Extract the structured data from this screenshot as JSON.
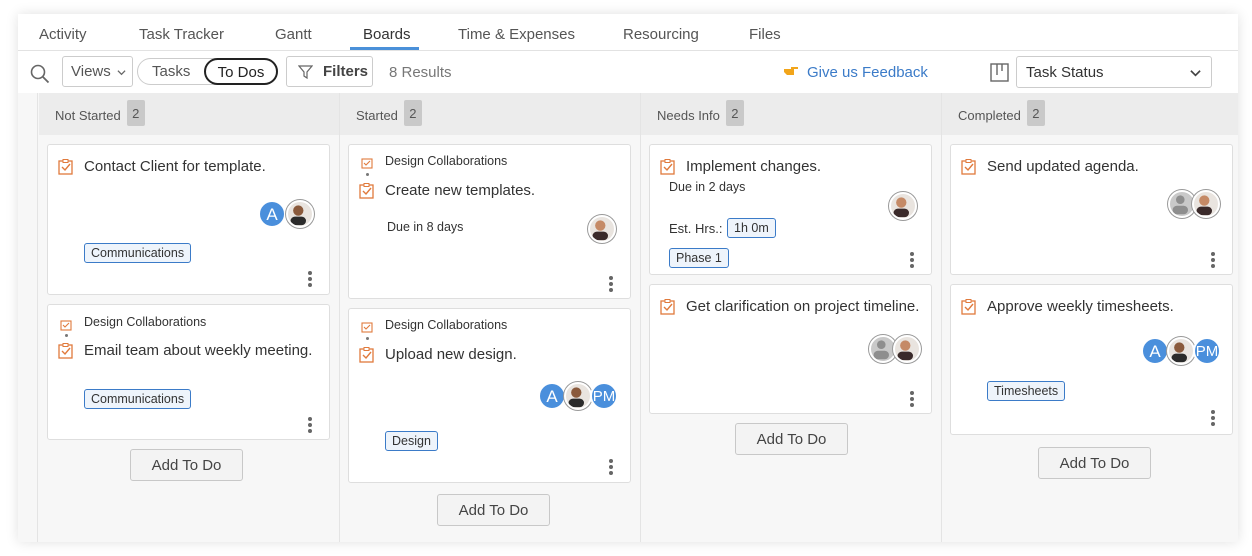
{
  "tabs": [
    {
      "label": "Activity"
    },
    {
      "label": "Task Tracker"
    },
    {
      "label": "Gantt"
    },
    {
      "label": "Boards"
    },
    {
      "label": "Time & Expenses"
    },
    {
      "label": "Resourcing"
    },
    {
      "label": "Files"
    }
  ],
  "active_tab": "Boards",
  "toolbar": {
    "search_icon": "search-icon",
    "views_label": "Views",
    "toggle_tasks": "Tasks",
    "toggle_todos": "To Dos",
    "filters_label": "Filters",
    "results": "8 Results",
    "feedback": "Give us Feedback",
    "group_by": "Task Status"
  },
  "colors": {
    "accent": "#4a90d9",
    "link": "#3b7bc8",
    "check": "#e07a3c",
    "avatar_blue": "#4a8fdc"
  },
  "columns": [
    {
      "title": "Not Started",
      "count": "2",
      "add_label": "Add To Do",
      "cards": [
        {
          "title": "Contact Client for template.",
          "tag": "Communications",
          "avatars": [
            "A",
            "photo"
          ]
        },
        {
          "parent": "Design Collaborations",
          "title": "Email team about weekly meeting.",
          "tag": "Communications"
        }
      ]
    },
    {
      "title": "Started",
      "count": "2",
      "add_label": "Add To Do",
      "cards": [
        {
          "parent": "Design Collaborations",
          "title": "Create new templates.",
          "due": "Due in 8 days",
          "avatars": [
            "photo"
          ]
        },
        {
          "parent": "Design Collaborations",
          "title": "Upload new design.",
          "tag": "Design",
          "avatars": [
            "A",
            "photo",
            "PM"
          ]
        }
      ]
    },
    {
      "title": "Needs Info",
      "count": "2",
      "add_label": "Add To Do",
      "cards": [
        {
          "title": "Implement changes.",
          "due": "Due in 2 days",
          "est_label": "Est. Hrs.:",
          "est_value": "1h 0m",
          "tag": "Phase 1",
          "avatars": [
            "photo"
          ]
        },
        {
          "title": "Get clarification on project timeline.",
          "avatars": [
            "gray",
            "photo"
          ]
        }
      ]
    },
    {
      "title": "Completed",
      "count": "2",
      "add_label": "Add To Do",
      "cards": [
        {
          "title": "Send updated agenda.",
          "avatars": [
            "gray",
            "photo"
          ]
        },
        {
          "title": "Approve weekly timesheets.",
          "tag": "Timesheets",
          "avatars": [
            "A",
            "photo",
            "PM"
          ]
        }
      ]
    }
  ]
}
